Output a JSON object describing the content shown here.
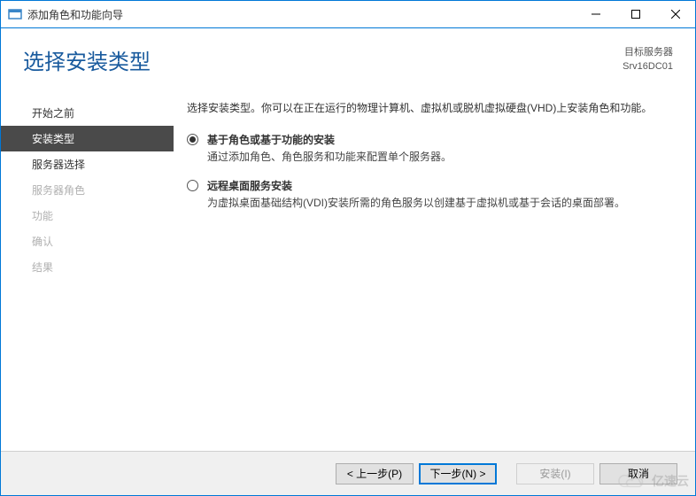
{
  "titlebar": {
    "title": "添加角色和功能向导"
  },
  "header": {
    "heading": "选择安装类型",
    "target_label": "目标服务器",
    "target_server": "Srv16DC01"
  },
  "sidebar": {
    "items": [
      {
        "label": "开始之前",
        "state": "normal"
      },
      {
        "label": "安装类型",
        "state": "active"
      },
      {
        "label": "服务器选择",
        "state": "normal"
      },
      {
        "label": "服务器角色",
        "state": "disabled"
      },
      {
        "label": "功能",
        "state": "disabled"
      },
      {
        "label": "确认",
        "state": "disabled"
      },
      {
        "label": "结果",
        "state": "disabled"
      }
    ]
  },
  "main": {
    "intro": "选择安装类型。你可以在正在运行的物理计算机、虚拟机或脱机虚拟硬盘(VHD)上安装角色和功能。",
    "options": [
      {
        "title": "基于角色或基于功能的安装",
        "desc": "通过添加角色、角色服务和功能来配置单个服务器。",
        "checked": true
      },
      {
        "title": "远程桌面服务安装",
        "desc": "为虚拟桌面基础结构(VDI)安装所需的角色服务以创建基于虚拟机或基于会话的桌面部署。",
        "checked": false
      }
    ]
  },
  "footer": {
    "prev": "< 上一步(P)",
    "next": "下一步(N) >",
    "install": "安装(I)",
    "cancel": "取消"
  },
  "watermark": {
    "text": "亿速云"
  }
}
